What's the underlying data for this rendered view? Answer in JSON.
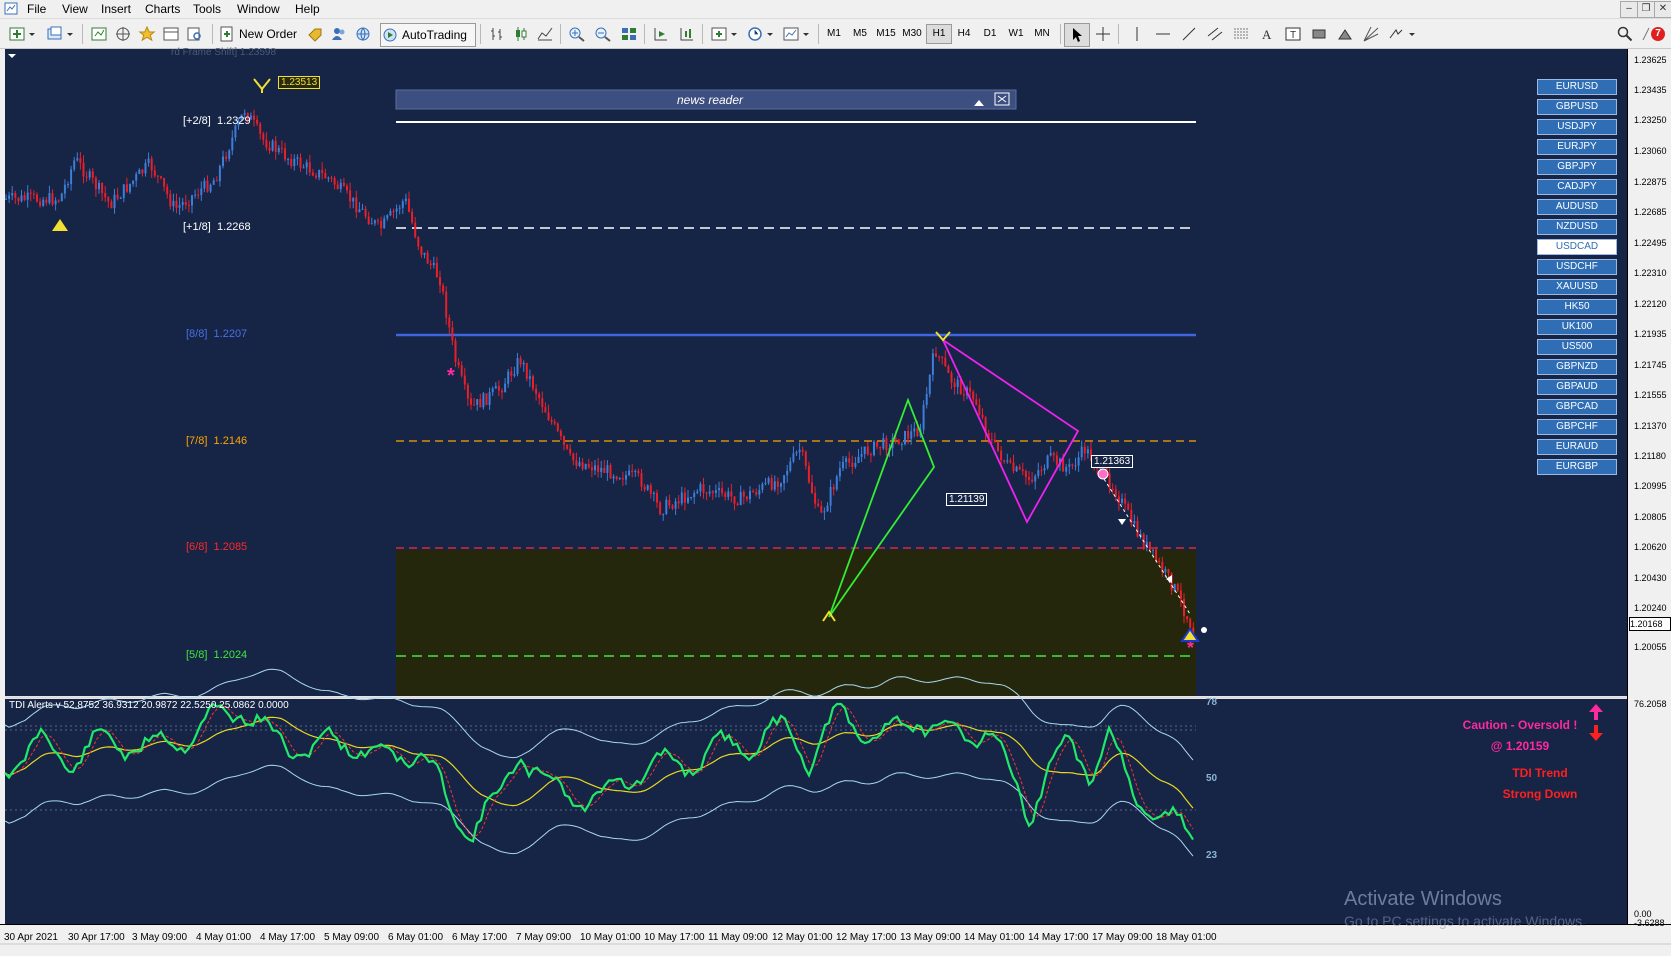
{
  "menu": [
    "File",
    "View",
    "Insert",
    "Charts",
    "Tools",
    "Window",
    "Help"
  ],
  "toolbar": {
    "new_order": "New Order",
    "autotrading": "AutoTrading",
    "timeframes": [
      "M1",
      "M5",
      "M15",
      "M30",
      "H1",
      "H4",
      "D1",
      "W1",
      "MN"
    ],
    "active_timeframe": "H1",
    "notification_count": "7"
  },
  "chart": {
    "faded_indicator_text": "rd Frame Shift]  1.23598",
    "news_reader_title": "news reader",
    "murrey_levels": [
      {
        "label": "[+2/8]",
        "value": "1.2329",
        "color": "#ffffff"
      },
      {
        "label": "[+1/8]",
        "value": "1.2268",
        "color": "#ffffff"
      },
      {
        "label": "[8/8]",
        "value": "1.2207",
        "color": "#4a6fe8"
      },
      {
        "label": "[7/8]",
        "value": "1.2146",
        "color": "#ffa500"
      },
      {
        "label": "[6/8]",
        "value": "1.2085",
        "color": "#ff2a2a"
      },
      {
        "label": "[5/8]",
        "value": "1.2024",
        "color": "#3ee83e"
      }
    ],
    "price_tags": {
      "high": "1.23513",
      "pattern_b": "1.21139",
      "pattern_d": "1.21363"
    },
    "price_axis": [
      "1.23625",
      "1.23435",
      "1.23250",
      "1.23060",
      "1.22875",
      "1.22685",
      "1.22495",
      "1.22310",
      "1.22120",
      "1.21935",
      "1.21745",
      "1.21555",
      "1.21370",
      "1.21180",
      "1.20995",
      "1.20805",
      "1.20620",
      "1.20430",
      "1.20240",
      "1.20168",
      "1.20055"
    ],
    "current_price": "1.20168",
    "time_axis": [
      "30 Apr 2021",
      "30 Apr 17:00",
      "3 May 09:00",
      "4 May 01:00",
      "4 May 17:00",
      "5 May 09:00",
      "6 May 01:00",
      "6 May 17:00",
      "7 May 09:00",
      "10 May 01:00",
      "10 May 17:00",
      "11 May 09:00",
      "12 May 01:00",
      "12 May 17:00",
      "13 May 09:00",
      "14 May 01:00",
      "14 May 17:00",
      "17 May 09:00",
      "18 May 01:00"
    ],
    "symbols": [
      "EURUSD",
      "GBPUSD",
      "USDJPY",
      "EURJPY",
      "GBPJPY",
      "CADJPY",
      "AUDUSD",
      "NZDUSD",
      "USDCAD",
      "USDCHF",
      "XAUUSD",
      "HK50",
      "UK100",
      "US500",
      "GBPNZD",
      "GBPAUD",
      "GBPCAD",
      "GBPCHF",
      "EURAUD",
      "EURGBP"
    ],
    "active_symbol": "USDCAD"
  },
  "tdi": {
    "header": "TDI Alerts v 52.8752 36.9312 20.9872 22.5250 25.0862 0.0000",
    "levels": [
      "78",
      "50",
      "23"
    ],
    "axis_top": "76.2058",
    "axis_bottom_1": "0.00",
    "axis_bottom_2": "-3.6288",
    "alert_line1": "Caution - Oversold !",
    "alert_line2": "@ 1.20159",
    "trend_line1": "TDI Trend",
    "trend_line2": "Strong Down"
  },
  "watermark": {
    "line1": "Activate Windows",
    "line2": "Go to PC settings to activate Windows."
  },
  "colors": {
    "chart_bg": "#162445",
    "bull_candle": "#3d7fd8",
    "bear_candle": "#e8202a",
    "tdi_rsi": "#22e86a",
    "tdi_signal": "#ff3030",
    "tdi_mid": "#e8d820",
    "tdi_bands": "#a8d8f0",
    "pattern_green": "#33ee33",
    "pattern_magenta": "#ee22ee"
  }
}
